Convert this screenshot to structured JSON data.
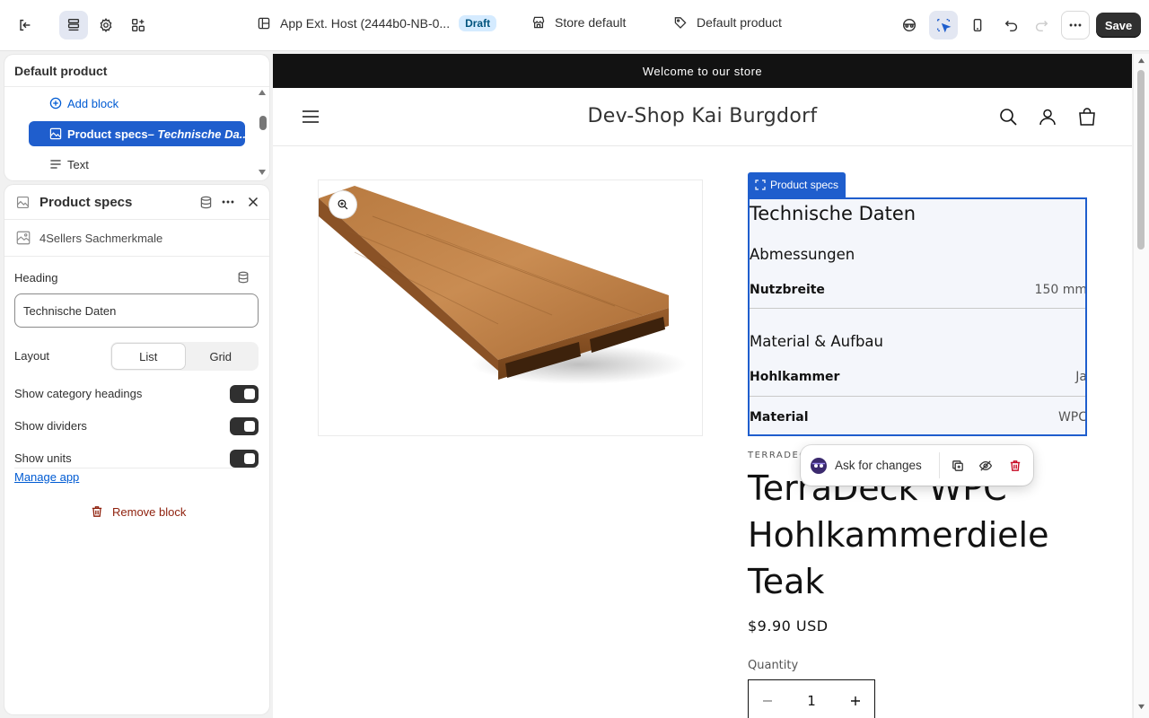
{
  "topbar": {
    "app_name": "App Ext. Host (2444b0-NB-0...",
    "status_badge": "Draft",
    "store_selector": "Store default",
    "template_selector": "Default product",
    "save_label": "Save"
  },
  "tree": {
    "title": "Default product",
    "add_block_label": "Add block",
    "selected_item_label": "Product specs",
    "selected_item_sublabel": " – Technische Da...",
    "text_item_label": "Text"
  },
  "settings": {
    "title": "Product specs",
    "app_source": "4Sellers Sachmerkmale",
    "heading_label": "Heading",
    "heading_value": "Technische Daten",
    "layout_label": "Layout",
    "layout_options": [
      "List",
      "Grid"
    ],
    "layout_selected": "List",
    "show_category_headings_label": "Show category headings",
    "show_category_headings": true,
    "show_dividers_label": "Show dividers",
    "show_dividers": true,
    "show_units_label": "Show units",
    "show_units": true,
    "manage_app_label": "Manage app",
    "remove_block_label": "Remove block"
  },
  "preview": {
    "announcement": "Welcome to our store",
    "store_name": "Dev-Shop Kai Burgdorf",
    "spec_tag": "Product specs",
    "specs": {
      "heading": "Technische Daten",
      "categories": [
        {
          "name": "Abmessungen",
          "rows": [
            {
              "key": "Nutzbreite",
              "value": "150 mm"
            }
          ]
        },
        {
          "name": "Material & Aufbau",
          "rows": [
            {
              "key": "Hohlkammer",
              "value": "Ja"
            },
            {
              "key": "Material",
              "value": "WPC"
            }
          ]
        }
      ]
    },
    "vendor": "TERRADECK",
    "product_title": "TerraDeck WPC Hohlkammerdiele Teak",
    "price": "$9.90 USD",
    "quantity_label": "Quantity",
    "quantity_value": "1",
    "ask_for_changes": "Ask for changes"
  },
  "colors": {
    "accent": "#1f5ecd",
    "link": "#005bd3",
    "destructive": "#8e1f0b",
    "dark": "#303030"
  }
}
